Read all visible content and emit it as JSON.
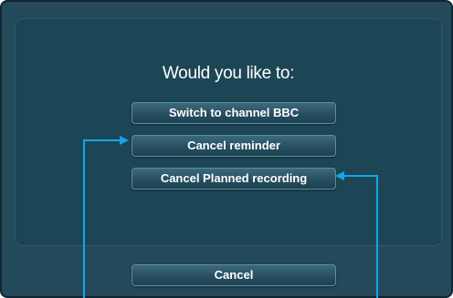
{
  "dialog": {
    "prompt": "Would you like to:",
    "options": [
      {
        "label": "Switch to channel BBC"
      },
      {
        "label": "Cancel reminder"
      },
      {
        "label": "Cancel Planned recording"
      }
    ],
    "cancel_label": "Cancel"
  },
  "colors": {
    "background": "#24495a",
    "panel": "#1c4656",
    "button_border": "#5c8ea0",
    "callout_arrow": "#16a6e6",
    "text": "#ffffff"
  },
  "annotations": {
    "arrows": [
      "callout-arrow-left",
      "callout-arrow-right"
    ]
  }
}
